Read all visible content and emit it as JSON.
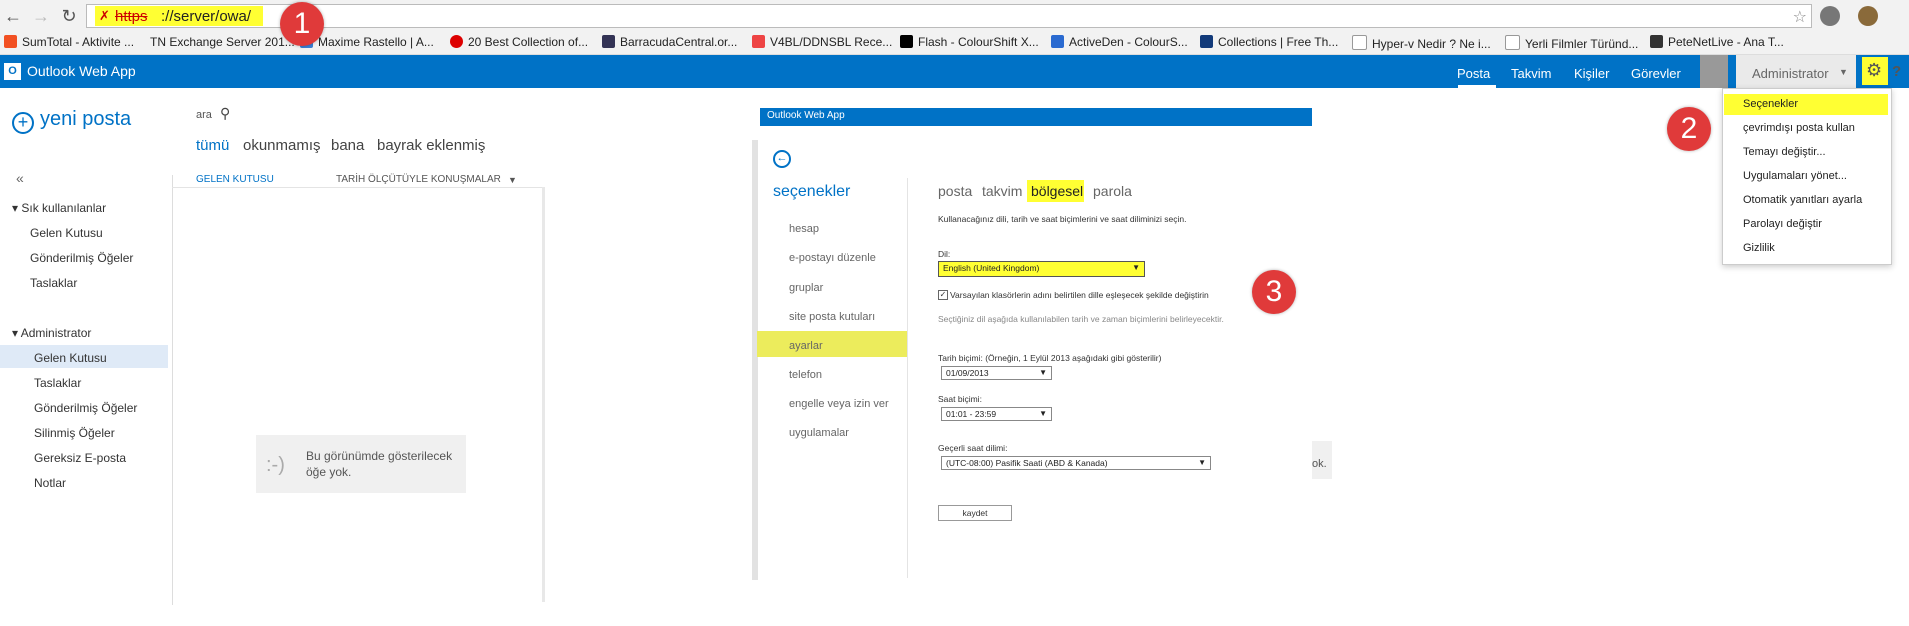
{
  "browser": {
    "url_scheme": "https",
    "url_rest": "://server/owa/",
    "bookmarks": [
      "SumTotal - Aktivite ...",
      "TN Exchange Server 201...",
      "Maxime Rastello | A...",
      "20 Best Collection of...",
      "BarracudaCentral.or...",
      "V4BL/DDNSBL Rece...",
      "Flash - ColourShift X...",
      "ActiveDen - ColourS...",
      "Collections | Free Th...",
      "Hyper-v Nedir ? Ne i...",
      "Yerli Filmler Türünd...",
      "PeteNetLive - Ana T..."
    ]
  },
  "owa": {
    "app_title": "Outlook Web App",
    "nav": [
      "Posta",
      "Takvim",
      "Kişiler",
      "Görevler"
    ],
    "user": "Administrator"
  },
  "sidebar": {
    "new_mail": "yeni posta",
    "favorites_header": "Sık kullanılanlar",
    "favorites": [
      "Gelen Kutusu",
      "Gönderilmiş Öğeler",
      "Taslaklar"
    ],
    "account_header": "Administrator",
    "folders": [
      "Gelen Kutusu",
      "Taslaklar",
      "Gönderilmiş Öğeler",
      "Silinmiş Öğeler",
      "Gereksiz E-posta",
      "Notlar"
    ]
  },
  "maillist": {
    "search_label": "ara",
    "filters": [
      "tümü",
      "okunmamış",
      "bana",
      "bayrak eklenmiş"
    ],
    "folder_label": "GELEN KUTUSU",
    "sort_label": "TARİH ÖLÇÜTÜYLE KONUŞMALAR",
    "empty_face": ":-)",
    "empty_text": "Bu görünümde gösterilecek öğe yok."
  },
  "options": {
    "header_title": "Outlook Web App",
    "title": "seçenekler",
    "nav": [
      "hesap",
      "e-postayı düzenle",
      "gruplar",
      "site posta kutuları",
      "ayarlar",
      "telefon",
      "engelle veya izin ver",
      "uygulamalar"
    ],
    "tabs": [
      "posta",
      "takvim",
      "bölgesel",
      "parola"
    ],
    "intro": "Kullanacağınız dili, tarih ve saat biçimlerini ve saat diliminizi seçin.",
    "language_label": "Dil:",
    "language_value": "English (United Kingdom)",
    "rename_folders_label": "Varsayılan klasörlerin adını belirtilen dille eşleşecek şekilde değiştirin",
    "note": "Seçtiğiniz dil aşağıda kullanılabilen tarih ve zaman biçimlerini belirleyecektir.",
    "date_format_label": "Tarih biçimi: (Örneğin, 1 Eylül 2013 aşağıdaki gibi gösterilir)",
    "date_format_value": "01/09/2013",
    "time_format_label": "Saat biçimi:",
    "time_format_value": "01:01 - 23:59",
    "timezone_label": "Geçerli saat dilimi:",
    "timezone_value": "(UTC-08:00) Pasifik Saati (ABD & Kanada)",
    "partial_text": "ok.",
    "save_label": "kaydet"
  },
  "menu": {
    "items": [
      "Seçenekler",
      "çevrimdışı posta kullan",
      "Temayı değiştir...",
      "Uygulamaları yönet...",
      "Otomatik yanıtları ayarla",
      "Parolayı değiştir",
      "Gizlilik"
    ]
  },
  "callouts": [
    "1",
    "2",
    "3"
  ],
  "colors": {
    "owa_blue": "#0072c6",
    "highlight": "#ffff33",
    "callout_red": "#e03a3a"
  }
}
